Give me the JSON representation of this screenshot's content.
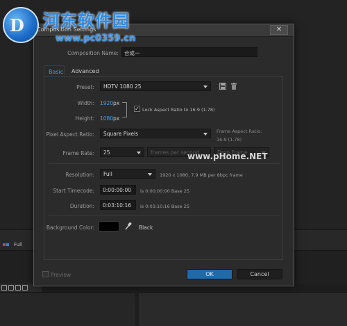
{
  "watermark": {
    "logo_glyph": "D",
    "title": "河东软件园",
    "url": "www.pc0359.cn",
    "overlay_text": "www.pHome.NET"
  },
  "background": {
    "panel_label": "Full"
  },
  "dialog": {
    "title": "Composition Settings",
    "close_glyph": "✕",
    "composition_name_label": "Composition Name:",
    "composition_name_value": "合成一",
    "tabs": [
      {
        "label": "Basic",
        "active": true
      },
      {
        "label": "Advanced",
        "active": false
      }
    ],
    "preset": {
      "label": "Preset:",
      "value": "HDTV 1080 25"
    },
    "width": {
      "label": "Width:",
      "value": "1920",
      "unit": "px"
    },
    "height": {
      "label": "Height:",
      "value": "1080",
      "unit": "px"
    },
    "lock_aspect": {
      "label": "Lock Aspect Ratio to 16:9 (1.78)",
      "checked": true,
      "check_glyph": "✓"
    },
    "pixel_aspect": {
      "label": "Pixel Aspect Ratio:",
      "value": "Square Pixels"
    },
    "frame_aspect": {
      "label": "Frame Aspect Ratio:",
      "value": "16:9 (1.78)"
    },
    "frame_rate": {
      "label": "Frame Rate:",
      "value": "25",
      "unit_dropdown": "frames per second",
      "drop_frame": "Drop Frame"
    },
    "resolution": {
      "label": "Resolution:",
      "value": "Full",
      "info": "1920 x 1080, 7.9 MB per 8bpc frame"
    },
    "start_timecode": {
      "label": "Start Timecode:",
      "value": "0:00:00:00",
      "info": "is 0:00:00:00  Base 25"
    },
    "duration": {
      "label": "Duration:",
      "value": "0:03:10:16",
      "info": "is 0:03:10:16  Base 25"
    },
    "background_color": {
      "label": "Background Color:",
      "color": "#000000",
      "name": "Black"
    },
    "preview_label": "Preview",
    "ok_label": "OK",
    "cancel_label": "Cancel"
  },
  "colors": {
    "accent": "#4a9ee6",
    "ok_button": "#1f6aa8"
  },
  "icons": [
    "save-preset-icon",
    "delete-preset-icon",
    "eyedropper-icon"
  ]
}
